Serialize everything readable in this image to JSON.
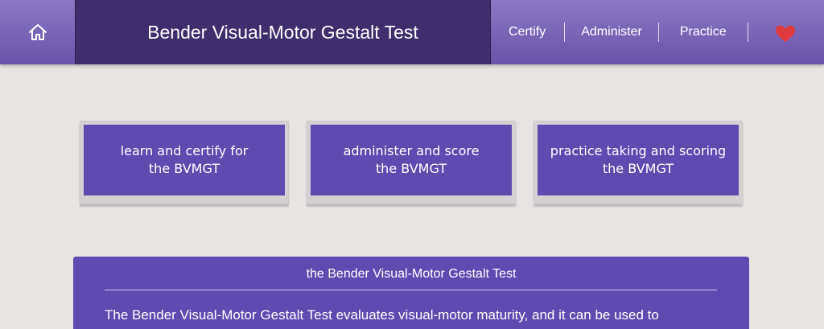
{
  "header": {
    "title": "Bender Visual-Motor Gestalt Test",
    "nav": [
      {
        "label": "Certify"
      },
      {
        "label": "Administer"
      },
      {
        "label": "Practice"
      }
    ],
    "icons": {
      "home": "home-icon",
      "favorite": "heart-icon"
    }
  },
  "cards": [
    {
      "line1": "learn and certify for",
      "line2": "the BVMGT"
    },
    {
      "line1": "administer and score",
      "line2": "the BVMGT"
    },
    {
      "line1": "practice taking and scoring",
      "line2": "the BVMGT"
    }
  ],
  "info": {
    "title": "the Bender Visual-Motor Gestalt Test",
    "body": "The Bender Visual-Motor Gestalt Test evaluates visual-motor maturity, and it can be used to"
  },
  "colors": {
    "header_gradient_top": "#8a78c4",
    "header_gradient_bottom": "#6a53aa",
    "title_bg": "#3f2d6e",
    "card_bg": "#5f4ab0",
    "heart": "#e0393e",
    "page_bg": "#e9e4e4"
  }
}
